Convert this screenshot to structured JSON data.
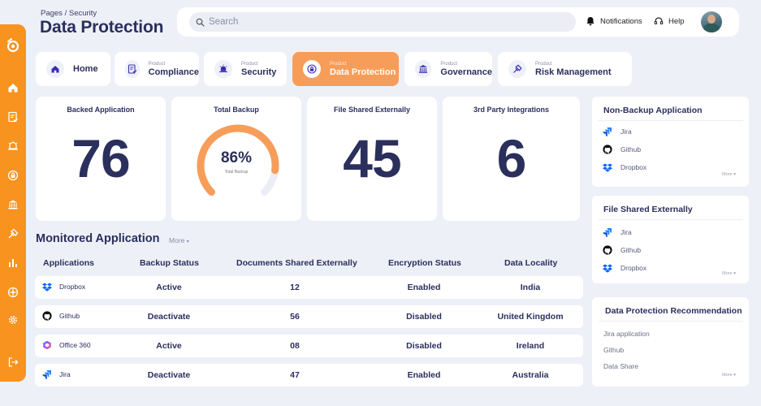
{
  "header": {
    "breadcrumb": "Pages / Security",
    "title": "Data Protection",
    "search_placeholder": "Search",
    "notifications_label": "Notifications",
    "help_label": "Help"
  },
  "sidebar": {
    "icons": [
      "logo-icon",
      "home-icon",
      "compliance-icon",
      "security-icon",
      "data-protection-icon",
      "governance-icon",
      "risk-icon",
      "analytics-icon",
      "integrations-icon",
      "settings-icon",
      "logout-icon"
    ]
  },
  "tabs": [
    {
      "sub": "",
      "label": "Home",
      "icon": "home-icon"
    },
    {
      "sub": "Product",
      "label": "Compliance",
      "icon": "compliance-icon"
    },
    {
      "sub": "Product",
      "label": "Security",
      "icon": "security-icon"
    },
    {
      "sub": "Product",
      "label": "Data Protection",
      "icon": "lock-icon",
      "active": true
    },
    {
      "sub": "Product",
      "label": "Governance",
      "icon": "bank-icon"
    },
    {
      "sub": "Product",
      "label": "Risk Management",
      "icon": "risk-icon"
    }
  ],
  "stats": {
    "backed": {
      "title": "Backed Application",
      "value": "76"
    },
    "backup": {
      "title": "Total Backup",
      "value": "86%",
      "label": "Total Backup",
      "percent": 86
    },
    "shared": {
      "title": "File Shared Externally",
      "value": "45"
    },
    "third_party": {
      "title": "3rd Party Integrations",
      "value": "6"
    }
  },
  "monitored": {
    "title": "Monitored Application",
    "more": "More",
    "headers": [
      "Applications",
      "Backup Status",
      "Documents Shared Externally",
      "Encryption Status",
      "Data Locality"
    ],
    "rows": [
      {
        "app": "Dropbox",
        "status": "Active",
        "docs": "12",
        "encryption": "Enabled",
        "locality": "India"
      },
      {
        "app": "Github",
        "status": "Deactivate",
        "docs": "56",
        "encryption": "Disabled",
        "locality": "United Kingdom"
      },
      {
        "app": "Office 360",
        "status": "Active",
        "docs": "08",
        "encryption": "Disabled",
        "locality": "Ireland"
      },
      {
        "app": "Jira",
        "status": "Deactivate",
        "docs": "47",
        "encryption": "Enabled",
        "locality": "Australia"
      }
    ]
  },
  "panels": {
    "non_backup": {
      "title": "Non-Backup Application",
      "items": [
        "Jira",
        "Github",
        "Dropbox"
      ],
      "more": "More"
    },
    "file_shared": {
      "title": "File Shared Externally",
      "items": [
        "Jira",
        "Github",
        "Dropbox"
      ],
      "more": "More"
    },
    "recommendation": {
      "title": "Data Protection Recommendation",
      "items": [
        "Jira application",
        "Github",
        "Data Share"
      ],
      "more": "More"
    }
  },
  "colors": {
    "accent": "#f7931e",
    "active_tab": "#f79d5a",
    "navy": "#2a2f5c",
    "jira": "#2684ff",
    "dropbox": "#0061ff",
    "gauge_track": "#eceef5"
  }
}
